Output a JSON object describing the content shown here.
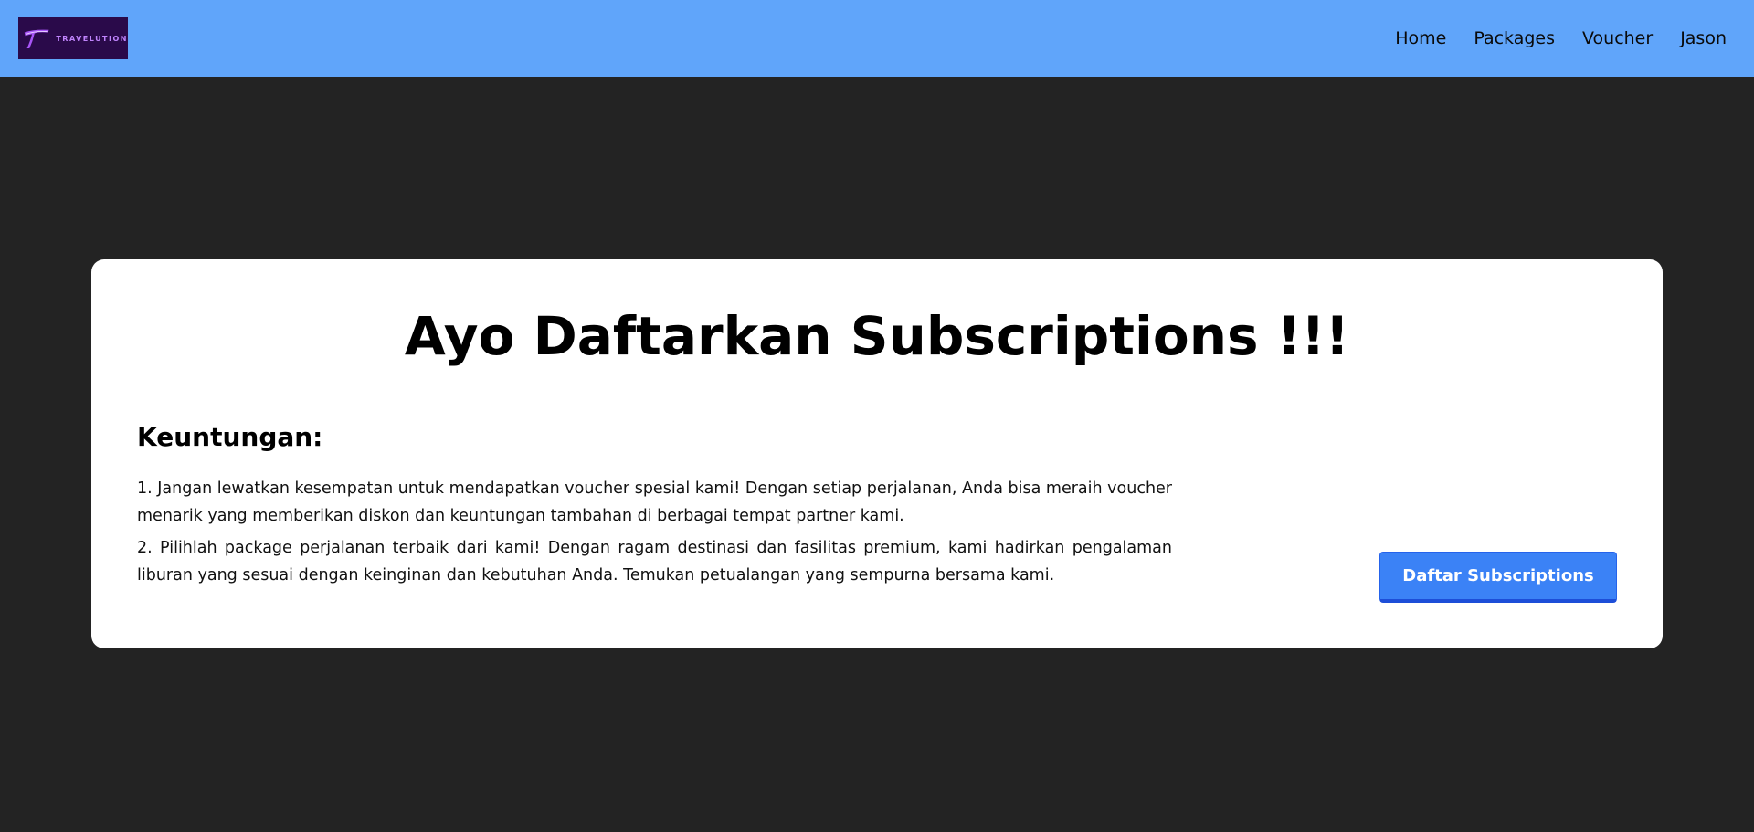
{
  "header": {
    "logo_text": "TRAVELUTION",
    "nav": [
      "Home",
      "Packages",
      "Voucher",
      "Jason"
    ]
  },
  "main": {
    "title": "Ayo Daftarkan Subscriptions !!!",
    "benefits_heading": "Keuntungan:",
    "benefits": [
      "1. Jangan lewatkan kesempatan untuk mendapatkan voucher spesial kami! Dengan setiap perjalanan, Anda bisa meraih voucher menarik yang memberikan diskon dan keuntungan tambahan di berbagai tempat partner kami.",
      "2. Pilihlah package perjalanan terbaik dari kami! Dengan ragam destinasi dan fasilitas premium, kami hadirkan pengalaman liburan yang sesuai dengan keinginan dan kebutuhan Anda. Temukan petualangan yang sempurna bersama kami."
    ],
    "subscribe_button": "Daftar Subscriptions"
  },
  "colors": {
    "navbar_bg": "#60a5fa",
    "page_bg": "#232323",
    "button_bg": "#3b82f6",
    "logo_bg": "#2a0a4a",
    "logo_accent": "#c084fc"
  },
  "icons": {
    "logo": "travelution-logo-icon"
  }
}
